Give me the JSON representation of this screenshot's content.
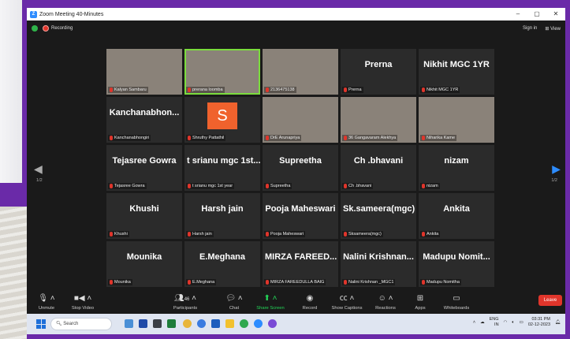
{
  "window": {
    "title": "Zoom Meeting 40-Minutes",
    "controls": [
      "–",
      "▢",
      "✕"
    ]
  },
  "infobar": {
    "recording": "Recording",
    "sign_in": "Sign in",
    "view": "View"
  },
  "navigation": {
    "page_left": "1/2",
    "page_right": "1/2"
  },
  "tiles": [
    {
      "big": "",
      "label": "Kalyan Sambaru",
      "video": "vid-a"
    },
    {
      "big": "",
      "label": "prerana loomba",
      "video": "vid-b",
      "active": true
    },
    {
      "big": "",
      "label": "2136475138",
      "video": "vid-c"
    },
    {
      "big": "Prerna",
      "label": "Prerna"
    },
    {
      "big": "Nikhit MGC 1YR",
      "label": "Nikhit MGC 1YR"
    },
    {
      "big": "Kanchanabhon...",
      "label": "Kanchanabhongiri"
    },
    {
      "big": "",
      "label": "Shruthy Pattathil",
      "avatar": "S"
    },
    {
      "big": "",
      "label": "DrE Arunapriya",
      "video": "vid-d"
    },
    {
      "big": "",
      "label": "36 Gangavaram Alekhya",
      "video": "vid-e"
    },
    {
      "big": "",
      "label": "Niharika Kame",
      "video": "vid-f"
    },
    {
      "big": "Tejasree Gowra",
      "label": "Tejasree Gowra"
    },
    {
      "big": "t srianu mgc 1st...",
      "label": "t srianu mgc 1st year"
    },
    {
      "big": "Supreetha",
      "label": "Supreetha"
    },
    {
      "big": "Ch .bhavani",
      "label": "Ch .bhavani"
    },
    {
      "big": "nizam",
      "label": "nizam"
    },
    {
      "big": "Khushi",
      "label": "Khushi"
    },
    {
      "big": "Harsh jain",
      "label": "Harsh jain"
    },
    {
      "big": "Pooja Maheswari",
      "label": "Pooja Maheswari"
    },
    {
      "big": "Sk.sameera(mgc)",
      "label": "Sksameera(mgc)"
    },
    {
      "big": "Ankita",
      "label": "Ankita"
    },
    {
      "big": "Mounika",
      "label": "Mounika"
    },
    {
      "big": "E.Meghana",
      "label": "E.Meghana"
    },
    {
      "big": "MIRZA FAREED...",
      "label": "MIRZA FAREEDULLA BAIG"
    },
    {
      "big": "Nalini Krishnan...",
      "label": "Nalini Krishnan _MGC1"
    },
    {
      "big": "Madupu Nomit...",
      "label": "Madupu Nomitha"
    }
  ],
  "toolbar": {
    "unmute": "Unmute",
    "stop_video": "Stop Video",
    "participants": "Participants",
    "participants_count": "46",
    "chat": "Chat",
    "share_screen": "Share Screen",
    "record": "Record",
    "show_captions": "Show Captions",
    "reactions": "Reactions",
    "apps": "Apps",
    "whiteboards": "Whiteboards",
    "leave": "Leave"
  },
  "taskbar": {
    "search_placeholder": "Search",
    "lang": "ENG",
    "lang2": "IN",
    "time": "03:31 PM",
    "date": "02-12-2023"
  }
}
